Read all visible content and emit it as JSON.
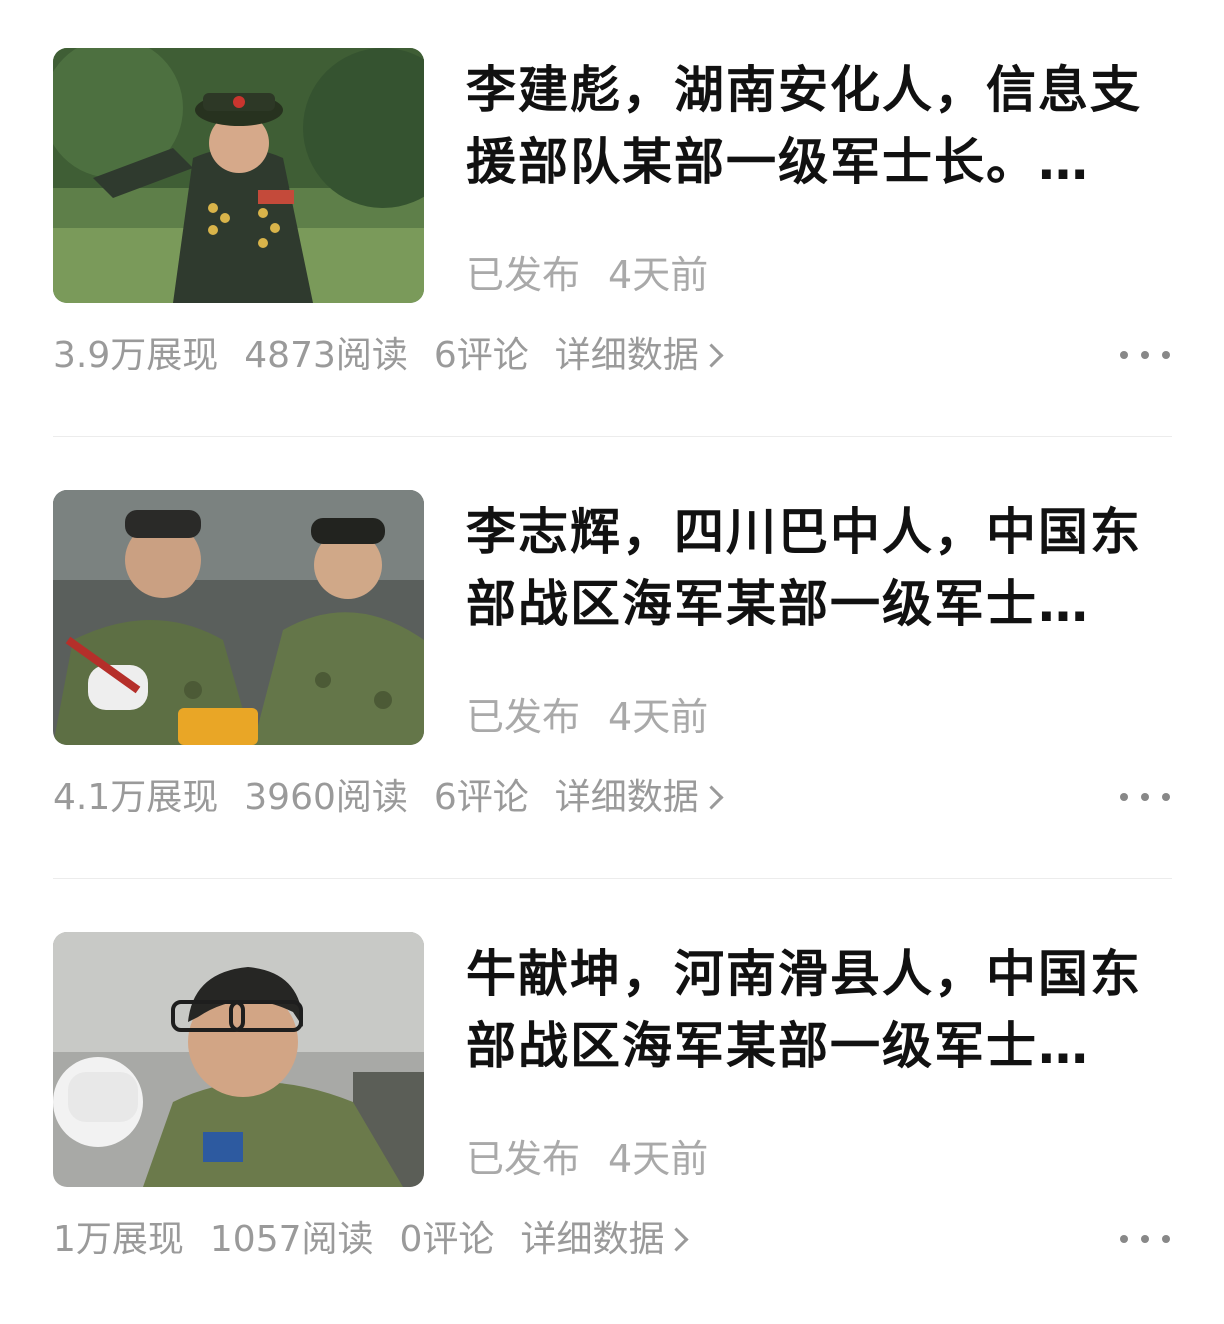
{
  "articles": [
    {
      "title": "李建彪，湖南安化人，信息支援部队某部一级军士长。…",
      "status": "已发布",
      "time": "4天前",
      "impressions": "3.9万展现",
      "reads": "4873阅读",
      "comments": "6评论",
      "details": "详细数据"
    },
    {
      "title": "李志辉，四川巴中人，中国东部战区海军某部一级军士…",
      "status": "已发布",
      "time": "4天前",
      "impressions": "4.1万展现",
      "reads": "3960阅读",
      "comments": "6评论",
      "details": "详细数据"
    },
    {
      "title": "牛献坤，河南滑县人，中国东部战区海军某部一级军士…",
      "status": "已发布",
      "time": "4天前",
      "impressions": "1万展现",
      "reads": "1057阅读",
      "comments": "0评论",
      "details": "详细数据"
    }
  ],
  "colors": {
    "meta_gray": "#a9a9a9",
    "stats_gray": "#9a9a9a",
    "title": "#111111",
    "divider": "#ececec"
  },
  "icons": {
    "more": "more-dots-icon",
    "chevron": "chevron-right-icon"
  }
}
